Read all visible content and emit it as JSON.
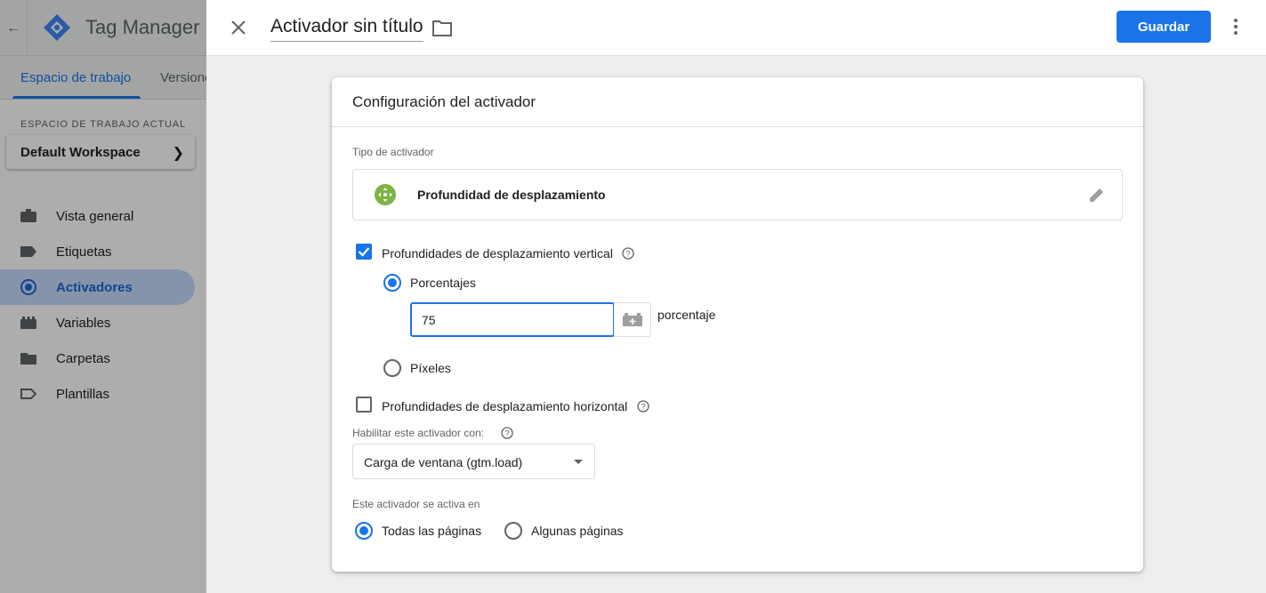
{
  "app": {
    "name": "Tag Manager",
    "tabs": [
      "Espacio de trabajo",
      "Versiones"
    ],
    "workspace_label": "ESPACIO DE TRABAJO ACTUAL",
    "workspace_name": "Default Workspace",
    "nav": [
      {
        "label": "Vista general",
        "icon": "briefcase-icon"
      },
      {
        "label": "Etiquetas",
        "icon": "tag-icon"
      },
      {
        "label": "Activadores",
        "icon": "trigger-icon"
      },
      {
        "label": "Variables",
        "icon": "variables-icon"
      },
      {
        "label": "Carpetas",
        "icon": "folder-icon"
      },
      {
        "label": "Plantillas",
        "icon": "template-icon"
      }
    ],
    "active_nav": "Activadores"
  },
  "editor": {
    "title": "Activador sin título",
    "save_label": "Guardar",
    "card_title": "Configuración del activador",
    "type_label": "Tipo de activador",
    "type_name": "Profundidad de desplazamiento",
    "vertical": {
      "label": "Profundidades de desplazamiento vertical",
      "checked": true,
      "percent_label": "Porcentajes",
      "percent_value": "75",
      "unit": "porcentaje",
      "pixels_label": "Píxeles",
      "selected": "Porcentajes"
    },
    "horizontal": {
      "label": "Profundidades de desplazamiento horizontal",
      "checked": false
    },
    "enable_label": "Habilitar este activador con:",
    "enable_value": "Carga de ventana (gtm.load)",
    "fires_label": "Este activador se activa en",
    "fires_all": "Todas las páginas",
    "fires_some": "Algunas páginas",
    "fires_selected": "Todas las páginas"
  },
  "colors": {
    "accent": "#1a73e8",
    "scroll_icon": "#7cb342"
  }
}
